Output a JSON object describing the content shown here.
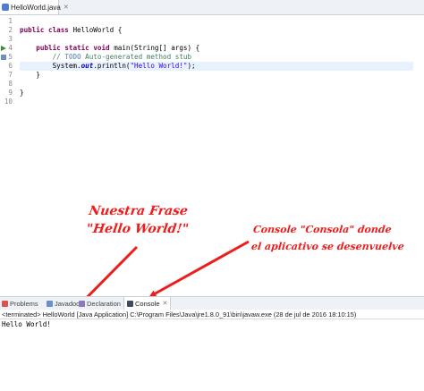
{
  "editor_tab": {
    "label": "HelloWorld.java",
    "close": "✕"
  },
  "code_lines": [
    {
      "n": "1",
      "text": ""
    },
    {
      "n": "2",
      "text": "public class HelloWorld {"
    },
    {
      "n": "3",
      "text": ""
    },
    {
      "n": "4",
      "text": "    public static void main(String[] args) {"
    },
    {
      "n": "5",
      "text": "        // TODO Auto-generated method stub"
    },
    {
      "n": "6",
      "text": "        System.out.println(\"Hello World!\");"
    },
    {
      "n": "7",
      "text": "    }"
    },
    {
      "n": "8",
      "text": ""
    },
    {
      "n": "9",
      "text": "}"
    },
    {
      "n": "10",
      "text": ""
    }
  ],
  "tokens": {
    "public": "public",
    "class": "class",
    "classname": " HelloWorld {",
    "static": "static",
    "void": "void",
    "main_rest": " main(String[] args) {",
    "comment_start": "// ",
    "todo": "TODO",
    "comment_rest": " Auto-generated method stub",
    "sys": "System.",
    "out": "out",
    "println": ".println(",
    "string": "\"Hello World!\"",
    "end": ");",
    "close_method": "    }",
    "close_class": "}"
  },
  "annotations": {
    "phrase_line1": "Nuestra Frase",
    "phrase_line2": "\"Hello World!\"",
    "console_line1": "Console \"Consola\" donde",
    "console_line2": "el aplicativo se desenvuelve"
  },
  "view_tabs": [
    {
      "label": "Problems"
    },
    {
      "label": "Javadoc"
    },
    {
      "label": "Declaration"
    },
    {
      "label": "Console"
    }
  ],
  "console": {
    "status": "<terminated> HelloWorld [Java Application] C:\\Program Files\\Java\\jre1.8.0_91\\bin\\javaw.exe (28 de jul de 2016 18:10:15)",
    "output": "Hello World!"
  },
  "colors": {
    "annotation": "#ee1c1c",
    "keyword": "#7f0055",
    "comment": "#3f7f5f",
    "string": "#2a00ff"
  }
}
